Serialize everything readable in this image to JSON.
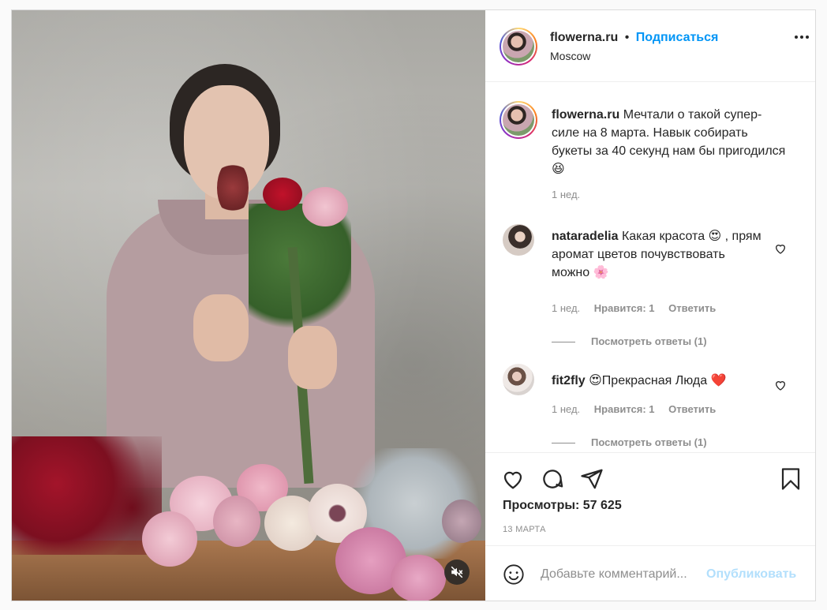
{
  "header": {
    "username": "flowerna.ru",
    "separator": "•",
    "follow_label": "Подписаться",
    "location": "Moscow"
  },
  "caption": {
    "username": "flowerna.ru",
    "text": "Мечтали о такой супер-силе на 8 марта. Навык собирать букеты за 40 секунд нам бы пригодился 😆",
    "time": "1 нед."
  },
  "comments": [
    {
      "username": "nataradelia",
      "text": "Какая красота 😍 , прям аромат цветов почувствовать можно 🌸",
      "time": "1 нед.",
      "likes": "Нравится: 1",
      "reply_label": "Ответить",
      "view_replies": "Посмотреть ответы (1)"
    },
    {
      "username": "fit2fly",
      "text": "😍Прекрасная Люда ❤️",
      "time": "1 нед.",
      "likes": "Нравится: 1",
      "reply_label": "Ответить",
      "view_replies": "Посмотреть ответы (1)"
    }
  ],
  "stats": {
    "views": "Просмотры: 57 625",
    "date": "13 МАРТА"
  },
  "add_comment": {
    "placeholder": "Добавьте комментарий...",
    "post_label": "Опубликовать"
  },
  "icons": {
    "like": "heart-icon",
    "comment": "comment-icon",
    "share": "paper-plane-icon",
    "save": "bookmark-icon",
    "emoji": "smiley-icon",
    "mute": "speaker-muted-icon",
    "more": "more-options-icon"
  },
  "colors": {
    "accent": "#0095f6",
    "muted": "#8e8e8e",
    "post_disabled": "#b2dffc",
    "text": "#262626"
  }
}
